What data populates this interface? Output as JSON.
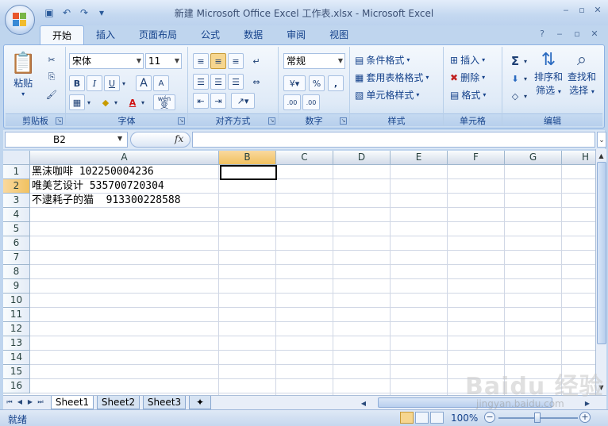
{
  "window": {
    "title": "新建 Microsoft Office Excel 工作表.xlsx - Microsoft Excel",
    "controls": [
      "‒",
      "▫",
      "✕"
    ]
  },
  "quick_access": [
    "save-icon",
    "undo-icon",
    "redo-icon",
    "customize-icon"
  ],
  "ribbon_tabs": [
    {
      "label": "开始",
      "active": true
    },
    {
      "label": "插入"
    },
    {
      "label": "页面布局"
    },
    {
      "label": "公式"
    },
    {
      "label": "数据"
    },
    {
      "label": "审阅"
    },
    {
      "label": "视图"
    }
  ],
  "ribbon": {
    "clipboard": {
      "label": "剪贴板",
      "paste": "粘贴"
    },
    "font": {
      "label": "字体",
      "font_name": "宋体",
      "font_size": "11",
      "bold": "B",
      "italic": "I",
      "underline": "U",
      "grow": "A",
      "shrink": "A",
      "wen": "wén",
      "bian": "变"
    },
    "alignment": {
      "label": "对齐方式"
    },
    "number": {
      "label": "数字",
      "format": "常规",
      "percent": "%",
      "comma": ",",
      "inc_decimal": ".00",
      "dec_decimal": ".00"
    },
    "styles": {
      "label": "样式",
      "conditional": "条件格式",
      "table": "套用表格格式",
      "cell_styles": "单元格样式"
    },
    "cells": {
      "label": "单元格",
      "insert": "插入",
      "delete": "删除",
      "format": "格式"
    },
    "editing": {
      "label": "编辑",
      "sum": "Σ",
      "sort_line1": "排序和",
      "sort_line2": "筛选",
      "find_line1": "查找和",
      "find_line2": "选择"
    }
  },
  "formula_bar": {
    "name_box": "B2",
    "fx": "fx",
    "formula": ""
  },
  "columns": [
    "A",
    "B",
    "C",
    "D",
    "E",
    "F",
    "G",
    "H"
  ],
  "rows": [
    "1",
    "2",
    "3",
    "4",
    "5",
    "6",
    "7",
    "8",
    "9",
    "10",
    "11",
    "12",
    "13",
    "14",
    "15",
    "16"
  ],
  "cells": {
    "A1": "黑沫咖啡 102250004236",
    "A2": "唯美艺设计 535700720304",
    "A3": "不逮耗子的猫  913300228588"
  },
  "sheet_tabs": [
    {
      "label": "Sheet1",
      "active": true
    },
    {
      "label": "Sheet2"
    },
    {
      "label": "Sheet3"
    }
  ],
  "status": {
    "ready": "就绪",
    "zoom": "100%"
  },
  "watermark": {
    "logo": "Baidu 经验",
    "url": "jingyan.baidu.com"
  }
}
